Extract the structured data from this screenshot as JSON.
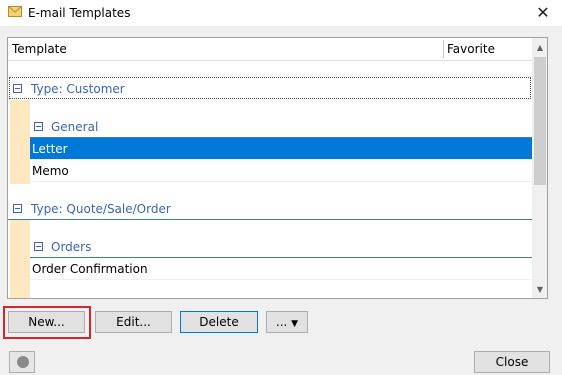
{
  "window": {
    "title": "E-mail Templates",
    "icon": "envelope-icon",
    "close_glyph": "✕"
  },
  "grid": {
    "columns": {
      "template": "Template",
      "favorite": "Favorite"
    },
    "groups": [
      {
        "label": "Type: Customer",
        "subgroups": [
          {
            "label": "General",
            "rows": [
              "Letter",
              "Memo"
            ]
          }
        ]
      },
      {
        "label": "Type: Quote/Sale/Order",
        "subgroups": [
          {
            "label": "Orders",
            "rows": [
              "Order Confirmation"
            ]
          }
        ]
      }
    ],
    "selected_row": "Letter",
    "scroll": {
      "up_glyph": "▲",
      "down_glyph": "▼"
    }
  },
  "buttons": {
    "new": "New...",
    "edit": "Edit...",
    "delete": "Delete",
    "more": "...",
    "more_caret": "▼",
    "close": "Close"
  },
  "colors": {
    "selection": "#0078d7",
    "group_text": "#3c64b4",
    "indent": "#fde8c2",
    "highlight": "#d9232d"
  }
}
